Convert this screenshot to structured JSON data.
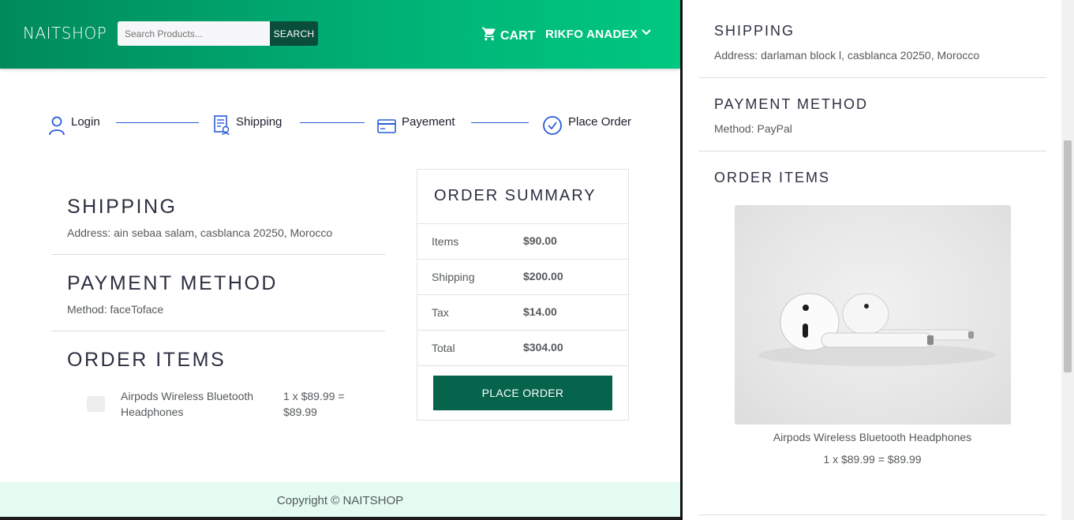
{
  "navbar": {
    "brand": "NAITSHOP",
    "search_placeholder": "Search Products...",
    "search_button": "SEARCH",
    "cart_label": "CART",
    "user_name": "RIKFO ANADEX"
  },
  "steps": [
    {
      "label": "Login",
      "icon": "user-icon"
    },
    {
      "label": "Shipping",
      "icon": "shipping-form-icon"
    },
    {
      "label": "Payement",
      "icon": "credit-card-icon"
    },
    {
      "label": "Place Order",
      "icon": "check-circle-icon"
    }
  ],
  "shipping": {
    "title": "SHIPPING",
    "address": "Address: ain sebaa salam, casblanca 20250, Morocco"
  },
  "payment": {
    "title": "PAYMENT METHOD",
    "method": "Method: faceToface"
  },
  "order_items": {
    "title": "ORDER ITEMS",
    "items": [
      {
        "name": "Airpods Wireless Bluetooth Headphones",
        "price": "1 x $89.99 = $89.99"
      }
    ]
  },
  "summary": {
    "title": "ORDER SUMMARY",
    "rows": [
      {
        "label": "Items",
        "value": "$90.00"
      },
      {
        "label": "Shipping",
        "value": "$200.00"
      },
      {
        "label": "Tax",
        "value": "$14.00"
      },
      {
        "label": "Total",
        "value": "$304.00"
      }
    ],
    "button": "PLACE ORDER"
  },
  "footer": {
    "text": "Copyright © NAITSHOP"
  },
  "panel": {
    "shipping_title": "SHIPPING",
    "shipping_address": "Address: darlaman block l, casblanca 20250, Morocco",
    "payment_title": "PAYMENT METHOD",
    "payment_method": "Method: PayPal",
    "items_title": "ORDER ITEMS",
    "item_name": "Airpods Wireless Bluetooth Headphones",
    "item_price": "1 x $89.99 = $89.99"
  },
  "colors": {
    "nav_start": "#008a5c",
    "nav_end": "#00c880",
    "button_dark": "#06634c",
    "step_blue": "#2a5cd6",
    "footer_bg": "#e3fbf1"
  }
}
